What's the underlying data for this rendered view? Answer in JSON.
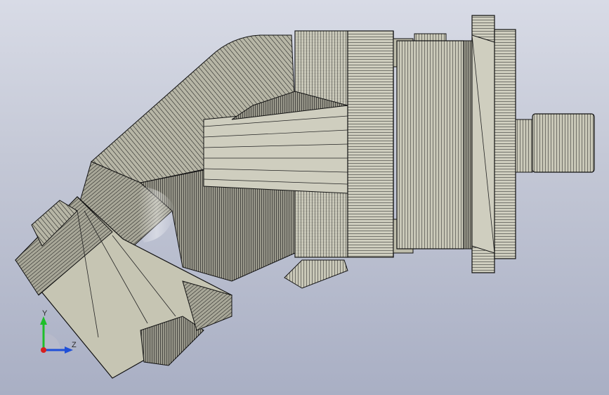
{
  "viewport": {
    "background_top": "#d8dbe6",
    "background_bottom": "#a9afc4",
    "model": "axial-piston-hydraulic-pump-bent-axis",
    "render_style": "shaded-with-edges"
  },
  "triad": {
    "y_label": "Y",
    "z_label": "Z",
    "y_color": "#1fbf2a",
    "z_color": "#1f4fd8",
    "x_color": "#d81f1f"
  }
}
